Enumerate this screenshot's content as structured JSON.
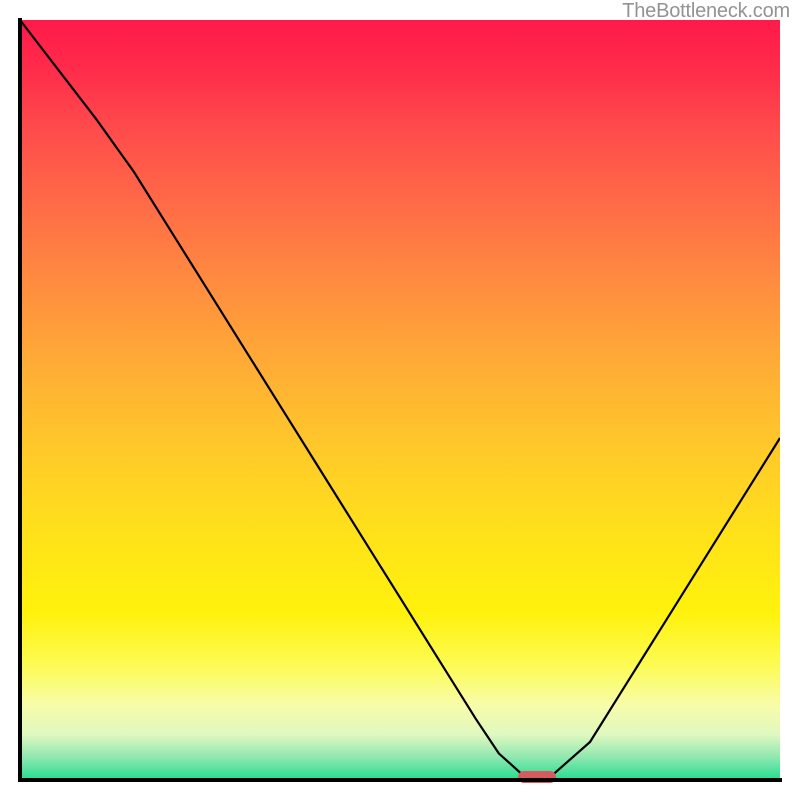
{
  "watermark": "TheBottleneck.com",
  "colors": {
    "axis": "#000000",
    "curve": "#000000",
    "marker": "#d85a60",
    "watermark": "#939393"
  },
  "chart_data": {
    "type": "line",
    "title": "",
    "xlabel": "",
    "ylabel": "",
    "xlim": [
      0,
      100
    ],
    "ylim": [
      0,
      100
    ],
    "grid": false,
    "legend": false,
    "description": "Bottleneck V-curve. Y-axis = bottleneck %, X-axis = component balance. Minimum (optimal) near x≈68. Background is vertical gradient red→yellow→green indicating bottleneck severity.",
    "series": [
      {
        "name": "bottleneck-curve",
        "x": [
          0,
          5,
          10,
          15,
          20,
          25,
          30,
          35,
          40,
          45,
          50,
          55,
          60,
          63,
          66,
          68,
          70,
          75,
          80,
          85,
          90,
          95,
          100
        ],
        "values": [
          100,
          93.5,
          87,
          80,
          72,
          64,
          56,
          48,
          40,
          32,
          24,
          16,
          8,
          3.5,
          0.8,
          0.4,
          0.6,
          5,
          13,
          21,
          29,
          37,
          45
        ]
      }
    ],
    "marker": {
      "x": 68,
      "y": 0.4,
      "width_pct": 5,
      "height_pct": 1.5
    },
    "gradient_stops": [
      {
        "pct": 0,
        "color": "#ff1a4a"
      },
      {
        "pct": 6,
        "color": "#ff2a4a"
      },
      {
        "pct": 14,
        "color": "#ff4a4c"
      },
      {
        "pct": 24,
        "color": "#ff6a47"
      },
      {
        "pct": 34,
        "color": "#ff8a40"
      },
      {
        "pct": 45,
        "color": "#ffab36"
      },
      {
        "pct": 56,
        "color": "#ffc82a"
      },
      {
        "pct": 68,
        "color": "#ffe21a"
      },
      {
        "pct": 78,
        "color": "#fff20c"
      },
      {
        "pct": 85,
        "color": "#fdfb55"
      },
      {
        "pct": 90,
        "color": "#f8fca8"
      },
      {
        "pct": 94,
        "color": "#e0f8c0"
      },
      {
        "pct": 97,
        "color": "#8fe8b0"
      },
      {
        "pct": 100,
        "color": "#24dd90"
      }
    ]
  }
}
